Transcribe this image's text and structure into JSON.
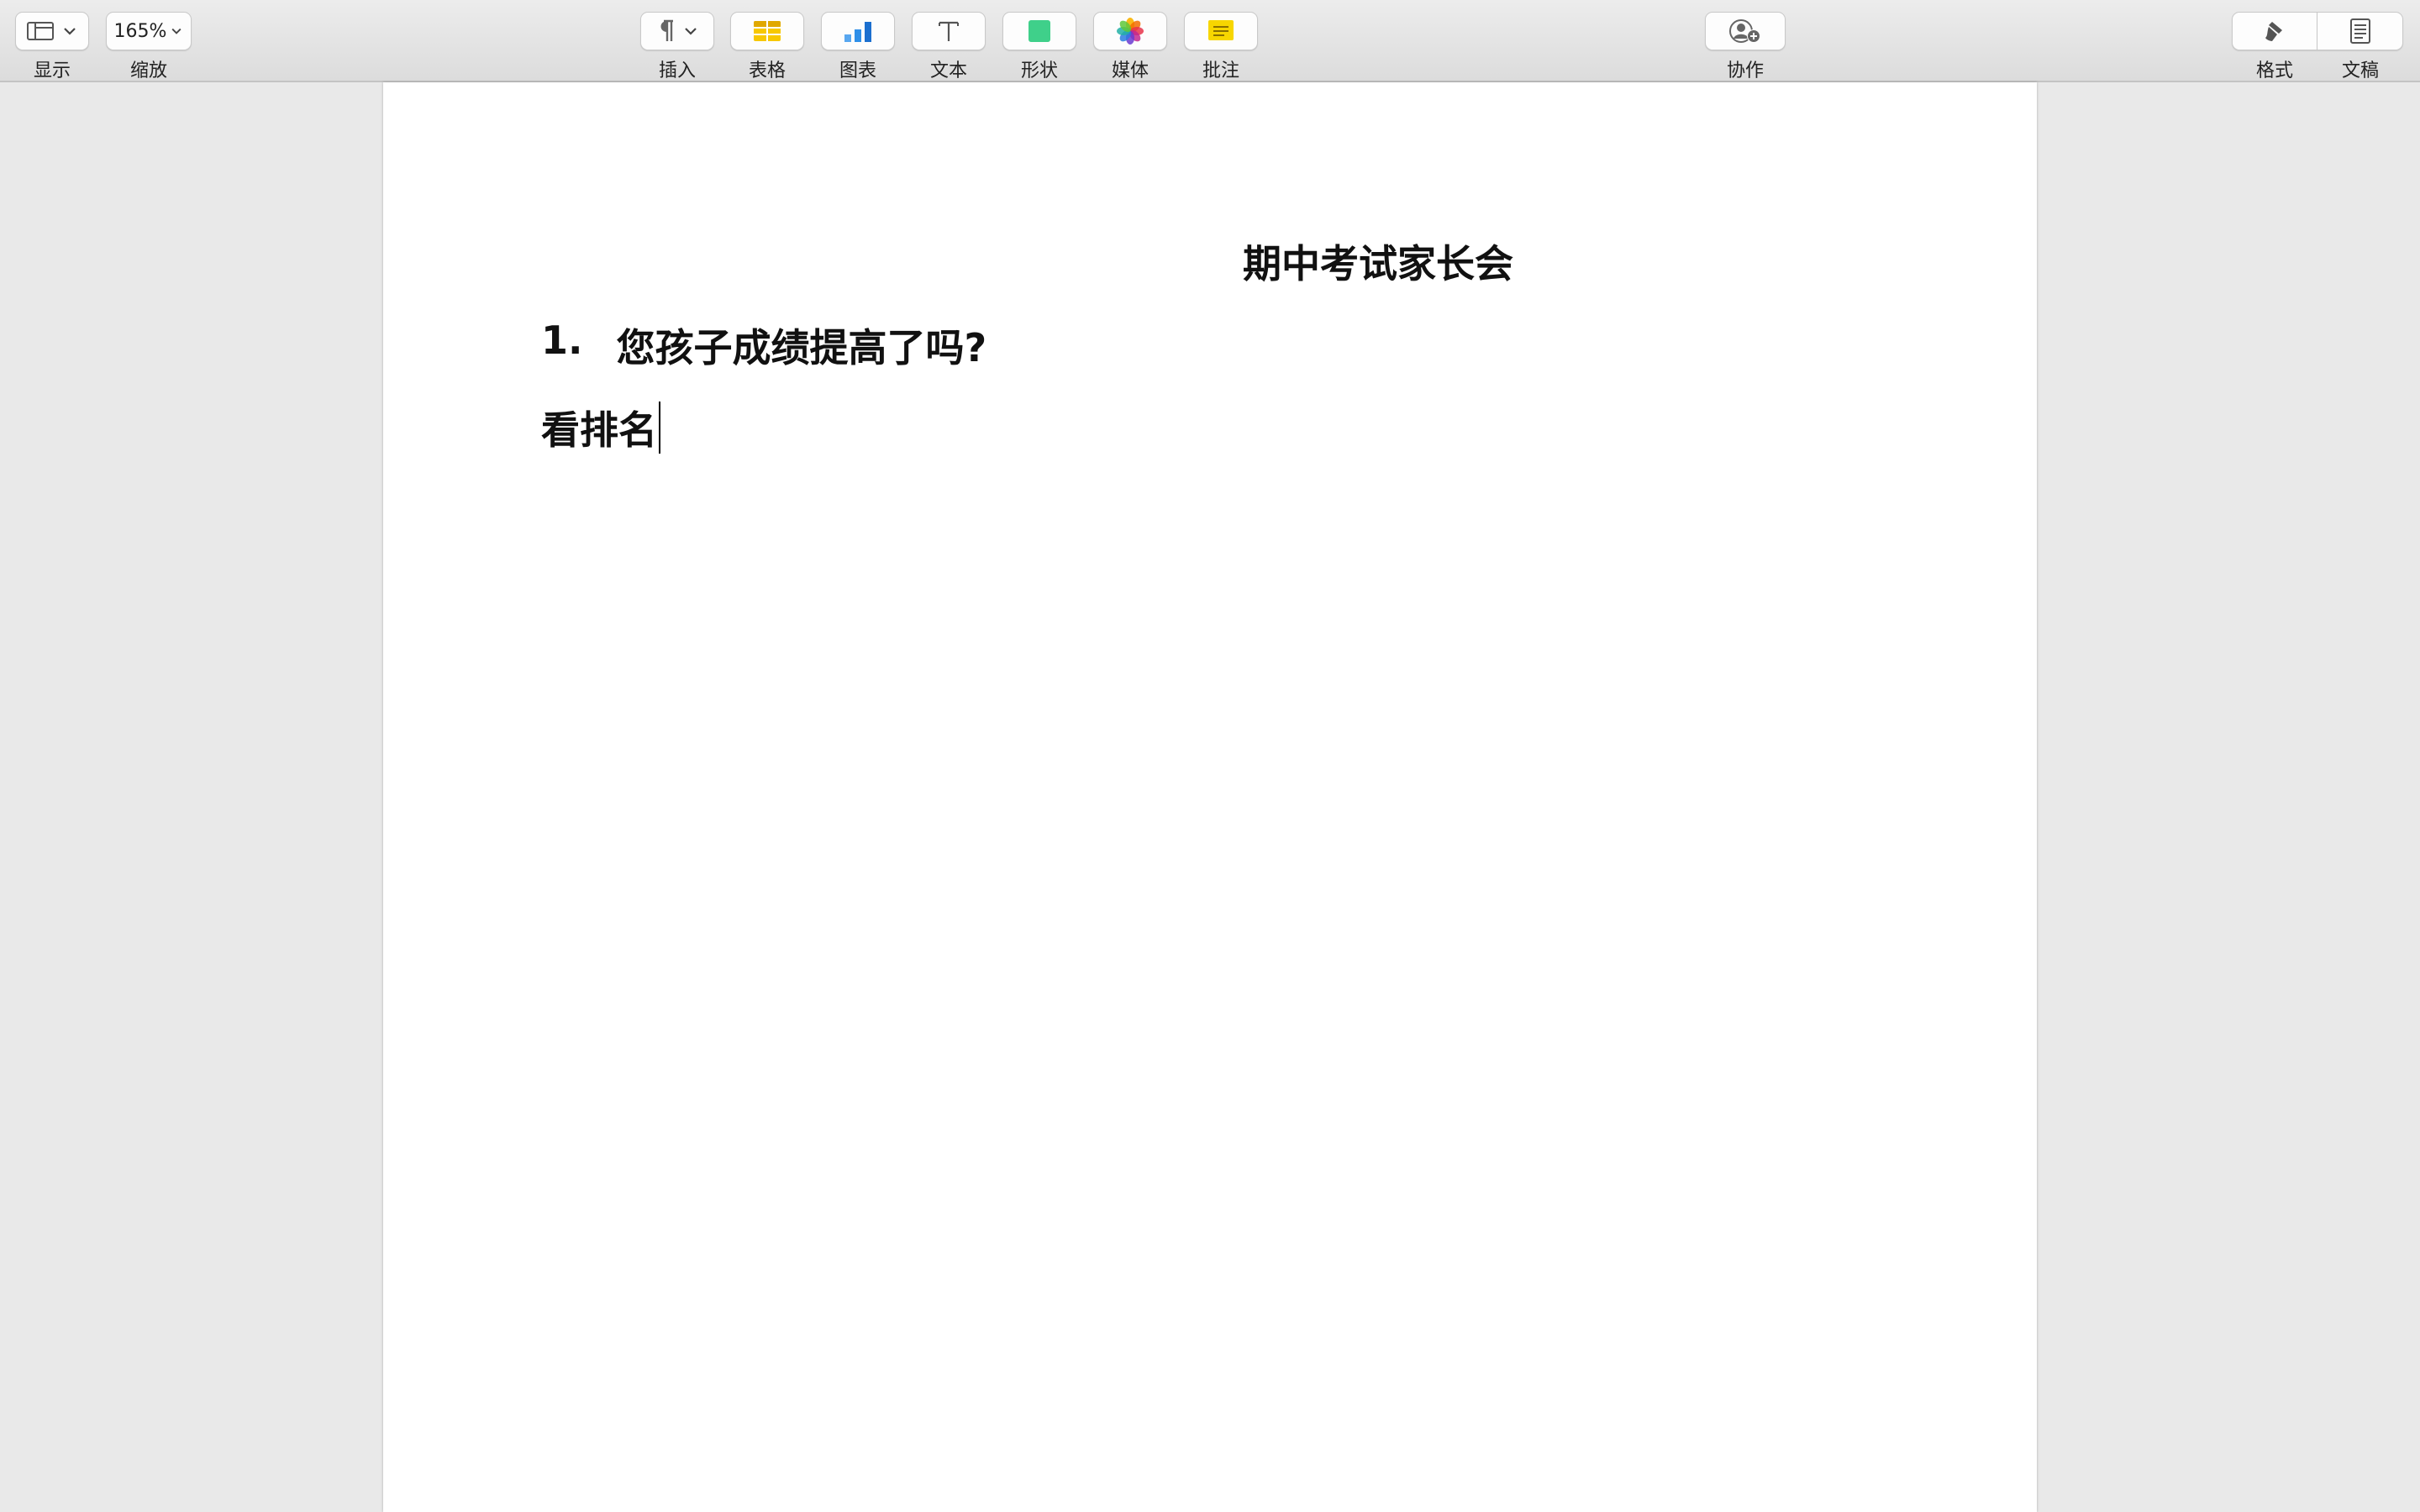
{
  "toolbar": {
    "view": {
      "label": "显示",
      "icon": "sidebar-view-icon"
    },
    "zoom": {
      "label": "缩放",
      "value": "165%"
    },
    "insert": {
      "label": "插入",
      "icon": "paragraph-icon"
    },
    "table": {
      "label": "表格",
      "icon": "table-icon",
      "color": "#f7c800"
    },
    "chart": {
      "label": "图表",
      "icon": "bar-chart-icon",
      "color": "#2e8fe8"
    },
    "text": {
      "label": "文本",
      "icon": "text-icon"
    },
    "shape": {
      "label": "形状",
      "icon": "shape-icon",
      "color": "#3fd08a"
    },
    "media": {
      "label": "媒体",
      "icon": "photos-icon"
    },
    "comment": {
      "label": "批注",
      "icon": "comment-icon",
      "color": "#f7d600"
    },
    "collaborate": {
      "label": "协作",
      "icon": "add-person-icon"
    },
    "format": {
      "label": "格式",
      "icon": "paintbrush-icon"
    },
    "document": {
      "label": "文稿",
      "icon": "document-icon"
    }
  },
  "document": {
    "title": "期中考试家长会",
    "list": [
      {
        "number": "1.",
        "text": "您孩子成绩提高了吗?"
      }
    ],
    "body": "看排名"
  }
}
